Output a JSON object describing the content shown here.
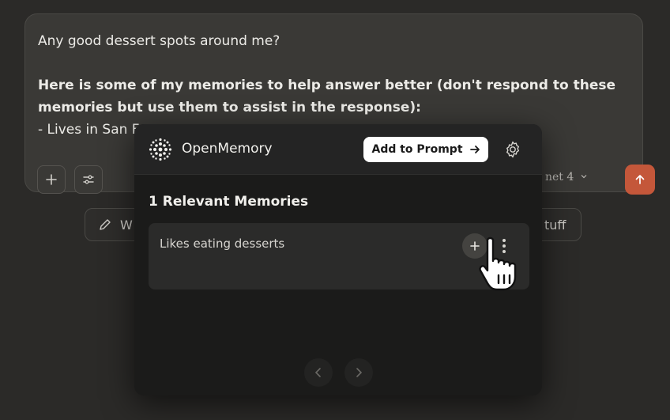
{
  "composer": {
    "message_line": "Any good dessert spots around me?",
    "memory_intro": "Here is some of my memories to help answer better (don't respond to these memories but use them to assist in the response):",
    "memory_line": "- Lives in San F",
    "model_label": "net 4"
  },
  "chips": {
    "left_label": "W",
    "right_label": "tuff"
  },
  "openmemory": {
    "brand": "OpenMemory",
    "add_to_prompt_label": "Add to Prompt",
    "section_title": "1 Relevant Memories",
    "memories": [
      {
        "text": "Likes eating desserts"
      }
    ]
  },
  "colors": {
    "send_button": "#c4573a",
    "popup_bg": "#1b1b1a",
    "card_bg": "#2b2b2a"
  },
  "icons": [
    "plus-icon",
    "sliders-icon",
    "chevron-down-icon",
    "arrow-up-icon",
    "pencil-icon",
    "openmemory-logo-icon",
    "arrow-right-icon",
    "gear-icon",
    "more-vertical-icon",
    "chevron-left-icon",
    "chevron-right-icon",
    "hand-cursor-icon"
  ]
}
